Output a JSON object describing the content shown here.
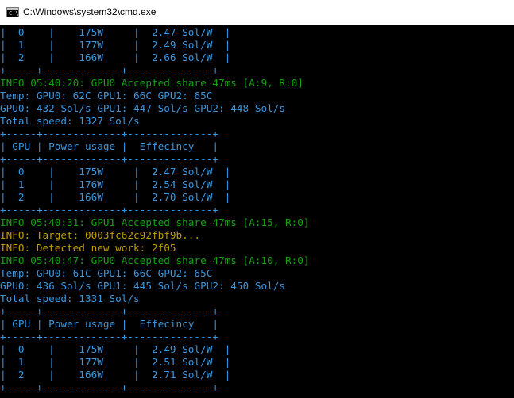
{
  "window": {
    "title": "C:\\Windows\\system32\\cmd.exe",
    "icon": "cmd-icon"
  },
  "console": {
    "lines": [
      {
        "text": "|  0    |    175W     |  2.47 Sol/W  |",
        "color": "#3a96dd"
      },
      {
        "text": "|  1    |    177W     |  2.49 Sol/W  |",
        "color": "#3a96dd"
      },
      {
        "text": "|  2    |    166W     |  2.66 Sol/W  |",
        "color": "#3a96dd"
      },
      {
        "text": "+-----+-------------+--------------+",
        "color": "#3a96dd"
      },
      {
        "text": "INFO 05:40:20: GPU0 Accepted share 47ms [A:9, R:0]",
        "color": "#13a10e"
      },
      {
        "text": "Temp: GPU0: 62C GPU1: 66C GPU2: 65C",
        "color": "#3a96dd"
      },
      {
        "text": "GPU0: 432 Sol/s GPU1: 447 Sol/s GPU2: 448 Sol/s",
        "color": "#3a96dd"
      },
      {
        "text": "Total speed: 1327 Sol/s",
        "color": "#3a96dd"
      },
      {
        "text": "+-----+-------------+--------------+",
        "color": "#3a96dd"
      },
      {
        "text": "| GPU | Power usage |  Effecincy   |",
        "color": "#3a96dd"
      },
      {
        "text": "+-----+-------------+--------------+",
        "color": "#3a96dd"
      },
      {
        "text": "|  0    |    175W     |  2.47 Sol/W  |",
        "color": "#3a96dd"
      },
      {
        "text": "|  1    |    176W     |  2.54 Sol/W  |",
        "color": "#3a96dd"
      },
      {
        "text": "|  2    |    166W     |  2.70 Sol/W  |",
        "color": "#3a96dd"
      },
      {
        "text": "+-----+-------------+--------------+",
        "color": "#3a96dd"
      },
      {
        "text": "INFO 05:40:31: GPU1 Accepted share 47ms [A:15, R:0]",
        "color": "#13a10e"
      },
      {
        "text": "INFO: Target: 0003fc62c92fbf9b...",
        "color": "#c19c00"
      },
      {
        "text": "INFO: Detected new work: 2f05",
        "color": "#c19c00"
      },
      {
        "text": "INFO 05:40:47: GPU0 Accepted share 47ms [A:10, R:0]",
        "color": "#13a10e"
      },
      {
        "text": "Temp: GPU0: 61C GPU1: 66C GPU2: 65C",
        "color": "#3a96dd"
      },
      {
        "text": "GPU0: 436 Sol/s GPU1: 445 Sol/s GPU2: 450 Sol/s",
        "color": "#3a96dd"
      },
      {
        "text": "Total speed: 1331 Sol/s",
        "color": "#3a96dd"
      },
      {
        "text": "+-----+-------------+--------------+",
        "color": "#3a96dd"
      },
      {
        "text": "| GPU | Power usage |  Effecincy   |",
        "color": "#3a96dd"
      },
      {
        "text": "+-----+-------------+--------------+",
        "color": "#3a96dd"
      },
      {
        "text": "|  0    |    175W     |  2.49 Sol/W  |",
        "color": "#3a96dd"
      },
      {
        "text": "|  1    |    177W     |  2.51 Sol/W  |",
        "color": "#3a96dd"
      },
      {
        "text": "|  2    |    166W     |  2.71 Sol/W  |",
        "color": "#3a96dd"
      },
      {
        "text": "+-----+-------------+--------------+",
        "color": "#3a96dd"
      }
    ]
  }
}
